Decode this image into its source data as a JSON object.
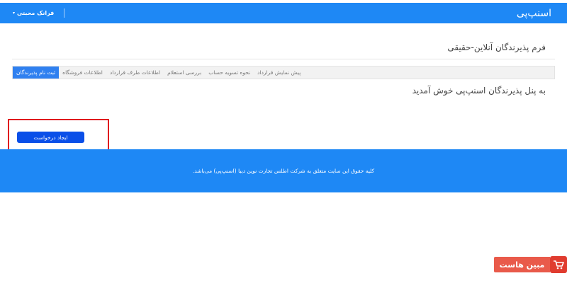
{
  "header": {
    "brand": "اسنپ‌پی",
    "user_name": "فرانک محبتی",
    "caret": "▾"
  },
  "page": {
    "title": "فرم پذیرندگان آنلاین-حقیقی",
    "tabs": [
      {
        "label": "ثبت نام پذیرندگان",
        "active": true
      },
      {
        "label": "اطلاعات فروشگاه",
        "active": false
      },
      {
        "label": "اطلاعات طرف قرارداد",
        "active": false
      },
      {
        "label": "بررسی استعلام",
        "active": false
      },
      {
        "label": "نحوه تسویه حساب",
        "active": false
      },
      {
        "label": "پیش نمایش قرارداد",
        "active": false
      }
    ],
    "welcome": "به پنل پذیرندگان اسنپ‌پی خوش آمدید",
    "create_button": "ایجاد درخواست"
  },
  "footer": {
    "text": "کلیه حقوق این سایت متعلق به شرکت اطلس تجارت نوین دیبا (اسنپ‌پی) می‌باشد."
  },
  "watermark": {
    "text": "مبین هاست",
    "icon": "cart-icon"
  },
  "colors": {
    "primary": "#1e88f5",
    "tab_active": "#2f80f0",
    "button": "#0a4fe8",
    "highlight": "#e0141e",
    "watermark": "#e95a4a"
  }
}
